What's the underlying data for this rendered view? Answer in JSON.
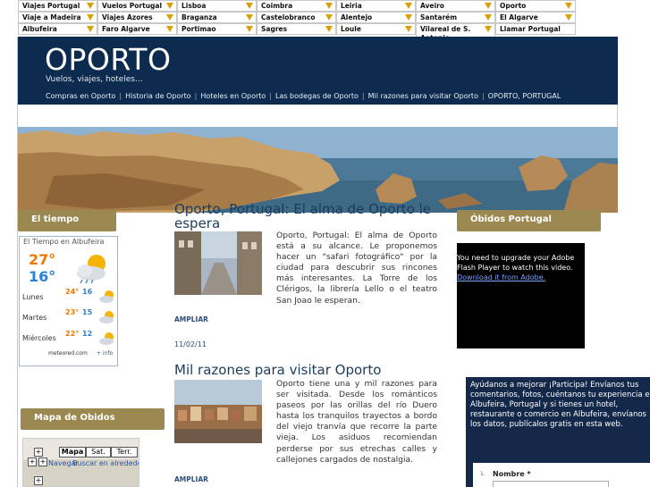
{
  "topnav": [
    [
      "Viajes Portugal",
      "Vuelos Portugal",
      "Lisboa",
      "Coimbra",
      "Leiria",
      "Aveiro",
      "Oporto"
    ],
    [
      "Viaje a Madeira",
      "Viajes Azores",
      "Braganza",
      "Castelobranco",
      "Alentejo",
      "Santarém",
      "El Algarve"
    ],
    [
      "Albufeira",
      "Faro Algarve",
      "Portimao",
      "Sagres",
      "Loule",
      "Vilareal de S. Antonio",
      "Llamar Portugal"
    ]
  ],
  "header": {
    "title": "OPORTO",
    "subtitle": "Vuelos, viajes, hoteles...",
    "menu": [
      "Compras en Oporto",
      "Historia de Oporto",
      "Hoteles en Oporto",
      "Las bodegas de Oporto",
      "Mil razones para visitar Oporto",
      "OPORTO, PORTUGAL"
    ]
  },
  "left": {
    "weather_heading": "El tiempo",
    "weather_title": "El Tiempo en Albufeira",
    "today_max": "27°",
    "today_min": "16°",
    "forecast": [
      {
        "day": "Lunes",
        "max": "24°",
        "min": "16"
      },
      {
        "day": "Martes",
        "max": "23°",
        "min": "15"
      },
      {
        "day": "Miércoles",
        "max": "22°",
        "min": "12"
      }
    ],
    "weather_footer": "meteored.com",
    "weather_info": "+ info",
    "map_heading": "Mapa de Obidos",
    "map_tabs": [
      "Mapa",
      "Sat.",
      "Terr."
    ],
    "map_links": [
      "Navegar",
      "Buscar en alrededor"
    ]
  },
  "posts": [
    {
      "title": "Oporto, Portugal: El alma de Oporto le espera",
      "text": "Oporto, Portugal: El alma de Oporto está a su alcance. Le proponemos hacer un \"safari fotográfico\" por la ciudad para descubrir sus rincones más interesantes. La Torre de los Clérigos, la librería Lello o el teatro San Joao le esperan.",
      "more": "AMPLIAR",
      "date": "11/02/11"
    },
    {
      "title": "Mil razones para visitar Oporto",
      "text": "Oporto tiene una y mil razones para ser visitada. Desde los románticos paseos por las orillas del río Duero hasta los tranquilos trayectos a bordo del viejo tranvía que recorre la parte vieja. Los asiduos recomiendan perderse por sus etrechas calles y callejones cargados de nostalgia.",
      "more": "AMPLIAR"
    }
  ],
  "right": {
    "heading": "Óbidos Portugal",
    "flash_text": "You need to upgrade your Adobe Flash Player to watch this video.",
    "flash_link": "Download it from Adobe.",
    "feedback_text": "Ayúdanos a mejorar ¡Participa! Envíanos tus comentarios, fotos, cuéntanos tu experiencia en Albufeira, Portugal y si tienes un hotel, restaurante o comercio en Albufeira, envíanos los datos, publícalos gratis en esta web.",
    "form_num": "1.",
    "form_label": "Nombre *"
  },
  "colors": {
    "header_bg": "#0d2b4e",
    "sidebar_head": "#9a8850",
    "link": "#2a4f7a",
    "feedback_bg": "#14294a"
  }
}
